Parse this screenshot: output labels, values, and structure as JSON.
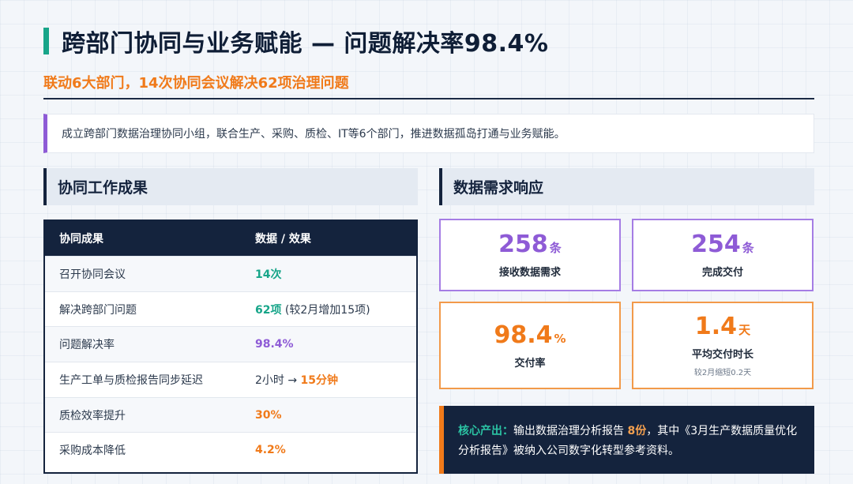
{
  "header": {
    "title": "跨部门协同与业务赋能 — 问题解决率98.4%",
    "subtitle": "联动6大部门，14次协同会议解决62项治理问题"
  },
  "intro": "成立跨部门数据治理协同小组，联合生产、采购、质检、IT等6个部门，推进数据孤岛打通与业务赋能。",
  "left_section": {
    "title": "协同工作成果",
    "table": {
      "headers": [
        "协同成果",
        "数据 / 效果"
      ],
      "rows": [
        {
          "item": "召开协同会议",
          "value": "14次",
          "extra": ""
        },
        {
          "item": "解决跨部门问题",
          "value": "62项",
          "extra": " (较2月增加15项)"
        },
        {
          "item": "问题解决率",
          "value": "98.4%",
          "extra": ""
        },
        {
          "item": "生产工单与质检报告同步延迟",
          "prefix": "2小时 → ",
          "value": "15分钟",
          "extra": ""
        },
        {
          "item": "质检效率提升",
          "value": "30%",
          "extra": ""
        },
        {
          "item": "采购成本降低",
          "value": "4.2%",
          "extra": ""
        }
      ]
    }
  },
  "right_section": {
    "title": "数据需求响应",
    "cards": [
      {
        "value": "258",
        "unit": "条",
        "label": "接收数据需求",
        "note": ""
      },
      {
        "value": "254",
        "unit": "条",
        "label": "完成交付",
        "note": ""
      },
      {
        "value": "98.4",
        "unit": "%",
        "label": "交付率",
        "note": ""
      },
      {
        "value": "1.4",
        "unit": "天",
        "label": "平均交付时长",
        "note": "较2月缩短0.2天"
      }
    ]
  },
  "core_output": {
    "label": "核心产出：",
    "text_before": "输出数据治理分析报告 ",
    "highlight": "8份",
    "text_after": "，其中《3月生产数据质量优化分析报告》被纳入公司数字化转型参考资料。"
  },
  "colors": {
    "teal": "#17a589",
    "purple": "#8e5bd6",
    "orange": "#f07a1a",
    "navy": "#14233d"
  }
}
